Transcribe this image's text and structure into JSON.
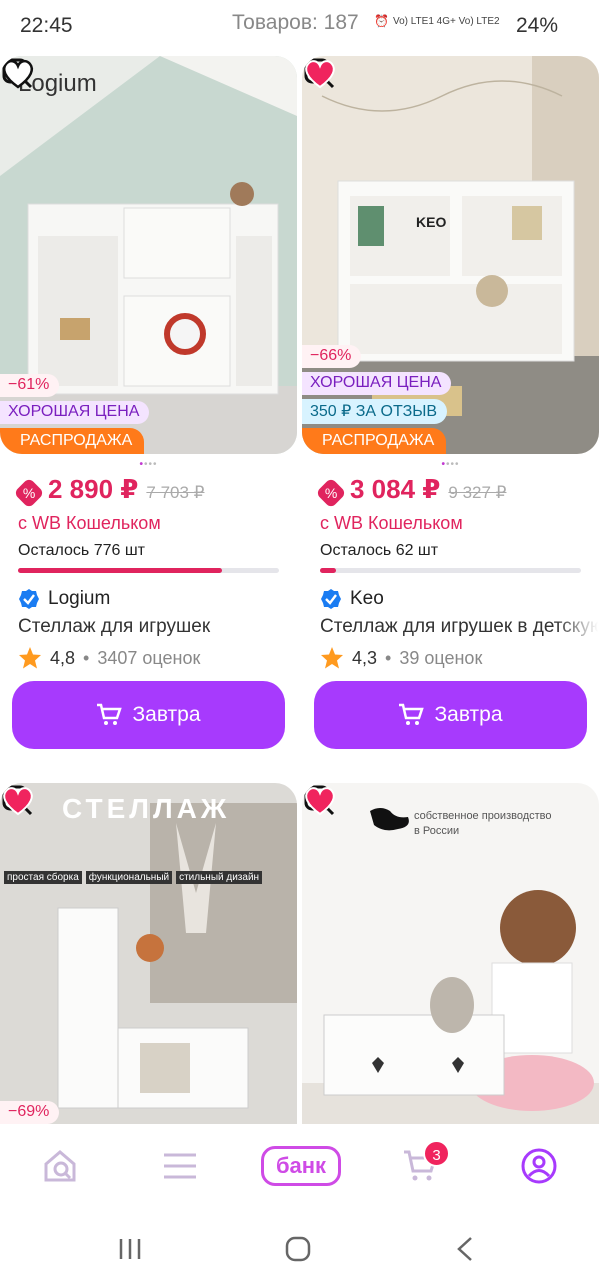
{
  "status_bar": {
    "time": "22:45",
    "items_count": "Товаров: 187",
    "network": "Vo) LTE1 4G+ Vo) LTE2",
    "battery": "24%"
  },
  "cards": [
    {
      "brand": "Logium",
      "image_logo_text": "Logium",
      "favorited": false,
      "tags": {
        "discount": "−61%",
        "good_price": "ХОРОШАЯ ЦЕНА",
        "sale": "РАСПРОДАЖА"
      },
      "price": "2 890 ₽",
      "old_price": "7 703 ₽",
      "wallet_text": "с WB Кошельком",
      "stock_text": "Осталось 776 шт",
      "stock_fraction": 0.78,
      "name": "Стеллаж для игрушек",
      "rating": "4,8",
      "reviews": "3407 оценок",
      "button_label": "Завтра"
    },
    {
      "brand": "Keo",
      "image_logo_text": "KEO",
      "favorited": true,
      "tags": {
        "discount": "−66%",
        "good_price": "ХОРОШАЯ ЦЕНА",
        "review_bonus": "350 ₽ ЗА ОТЗЫВ",
        "sale": "РАСПРОДАЖА"
      },
      "price": "3 084 ₽",
      "old_price": "9 327 ₽",
      "wallet_text": "с WB Кошельком",
      "stock_text": "Осталось 62 шт",
      "stock_fraction": 0.06,
      "name": "Стеллаж для игрушек в детскую",
      "rating": "4,3",
      "reviews": "39 оценок",
      "button_label": "Завтра"
    },
    {
      "favorited": true,
      "image_title": "СТЕЛЛАЖ",
      "image_features": [
        "простая сборка",
        "функциональный",
        "стильный дизайн"
      ],
      "tags": {
        "discount": "−69%"
      }
    },
    {
      "favorited": true,
      "image_text": "собственное производство в России"
    }
  ],
  "bottom_nav": {
    "bank_label": "банк",
    "cart_count": "3"
  },
  "colors": {
    "accent": "#a73afd",
    "price": "#e0245e",
    "sale": "#ff7a1a"
  }
}
